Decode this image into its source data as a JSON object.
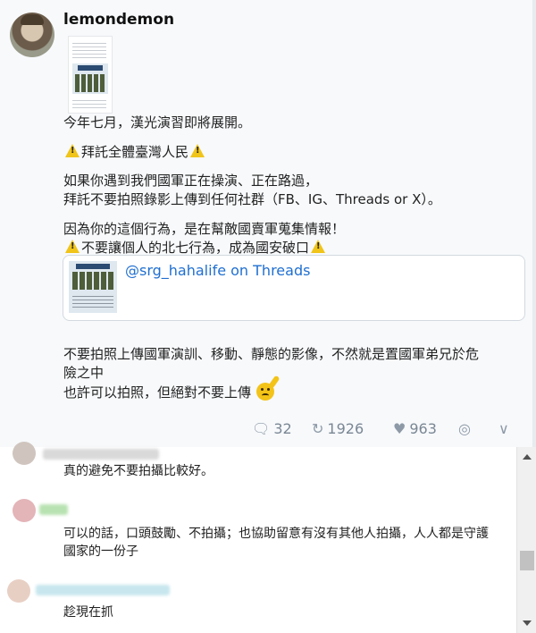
{
  "post": {
    "username": "lemondemon",
    "line1": "今年七月，漢光演習即將展開。",
    "line2": "拜託全體臺灣人民",
    "line3": "如果你遇到我們國軍正在操演、正在路過，",
    "line4": "拜託不要拍照錄影上傳到任何社群（FB、IG、Threads or X）。",
    "line5": "因為你的這個行為，是在幫敵國賣軍蒐集情報！",
    "line6": "不要讓個人的北七行為，成為國安破口",
    "link_card_title": "@srg_hahalife on Threads",
    "line7": "不要拍照上傳國軍演訓、移動、靜態的影像，不然就是置國軍弟兄於危",
    "line8": "險之中",
    "line9": "也許可以拍照，但絕對不要上傳",
    "stats": {
      "comments": "32",
      "reposts": "1926",
      "likes": "963"
    },
    "icons": [
      "comment-icon",
      "repost-icon",
      "heart-icon",
      "globe-icon",
      "chevron-down-icon"
    ]
  },
  "comments": [
    {
      "text": "真的避免不要拍攝比較好。"
    },
    {
      "text": "可以的話，口頭鼓勵、不拍攝；也協助留意有沒有其他人拍攝，人人都是守護"
    },
    {
      "text_cont": "國家的一份子"
    },
    {
      "text": "趁現在抓"
    }
  ],
  "colors": {
    "link": "#1f6fd1",
    "post_bg": "#f7f9fb",
    "stat_gray": "#7a8794"
  }
}
